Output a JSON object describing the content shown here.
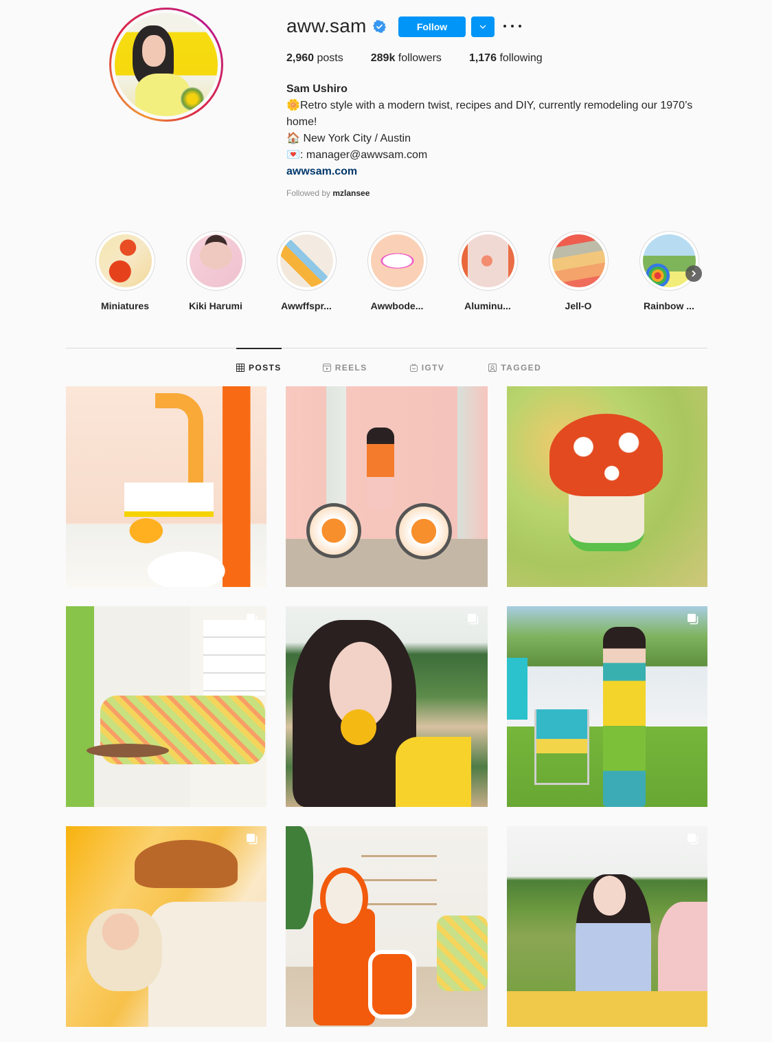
{
  "profile": {
    "username": "aww.sam",
    "verified": true,
    "follow_label": "Follow",
    "dropdown_icon": "chevron-down-icon",
    "more_icon": "ellipsis-icon",
    "stats": {
      "posts_count": "2,960",
      "posts_label": "posts",
      "followers_count": "289k",
      "followers_label": "followers",
      "following_count": "1,176",
      "following_label": "following"
    },
    "full_name": "Sam Ushiro",
    "bio_lines": [
      {
        "emoji": "🌼",
        "text": "Retro style with a modern twist, recipes and DIY, currently remodeling our 1970’s home!"
      },
      {
        "emoji": "🏠",
        "text": " New York City / Austin"
      },
      {
        "emoji": "💌",
        "text": ": manager@awwsam.com"
      }
    ],
    "website": "awwsam.com",
    "followed_by_prefix": "Followed by",
    "followed_by_user": "mzlansee"
  },
  "highlights": [
    {
      "label": "Miniatures"
    },
    {
      "label": "Kiki Harumi"
    },
    {
      "label": "Awwffspr..."
    },
    {
      "label": "Awwbode..."
    },
    {
      "label": "Aluminu..."
    },
    {
      "label": "Jell-O"
    },
    {
      "label": "Rainbow ..."
    }
  ],
  "tabs": [
    {
      "label": "POSTS",
      "icon": "grid-icon",
      "active": true
    },
    {
      "label": "REELS",
      "icon": "reels-icon",
      "active": false
    },
    {
      "label": "IGTV",
      "icon": "igtv-icon",
      "active": false
    },
    {
      "label": "TAGGED",
      "icon": "tagged-icon",
      "active": false
    }
  ],
  "posts": [
    {
      "alt": "Orange and yellow retro office room",
      "carousel": false
    },
    {
      "alt": "Woman with pink bicycle by pink wall",
      "carousel": false
    },
    {
      "alt": "Mushroom cake with red frosting",
      "carousel": false
    },
    {
      "alt": "Retro living room with floral couch",
      "carousel": true
    },
    {
      "alt": "Woman smelling yellow flower in field",
      "carousel": true
    },
    {
      "alt": "Woman with vintage stroller on lawn",
      "carousel": true
    },
    {
      "alt": "Man in hat holding baby, Proud Papa shirt",
      "carousel": true
    },
    {
      "alt": "Orange vanity and mirror in retro room",
      "carousel": false
    },
    {
      "alt": "Woman holding baby in park",
      "carousel": true
    }
  ],
  "colors": {
    "accent": "#0095f6",
    "link": "#00376b",
    "text": "#262626",
    "muted": "#8e8e8e",
    "background": "#fafafa"
  }
}
